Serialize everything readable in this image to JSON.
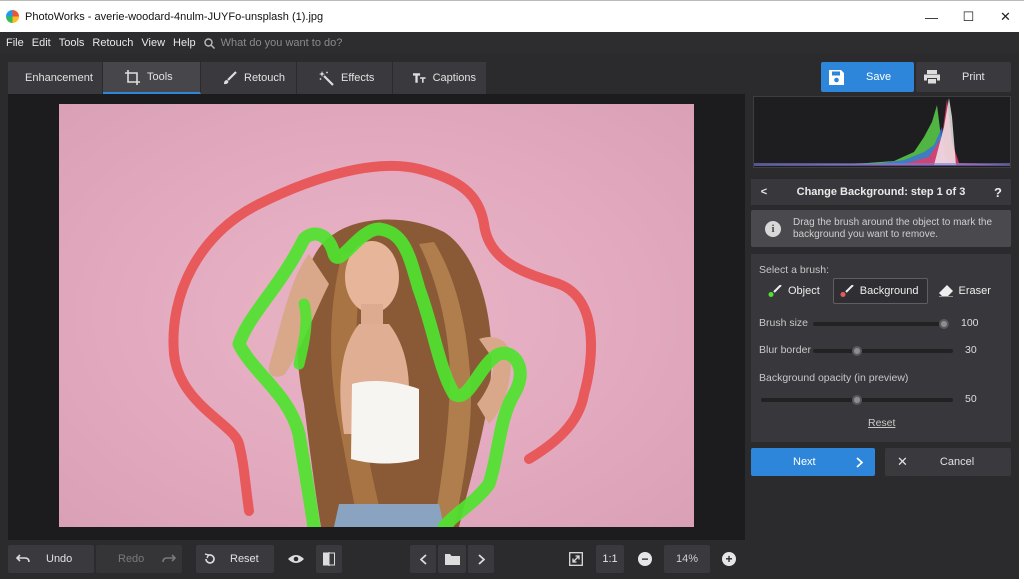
{
  "window": {
    "title": "PhotoWorks - averie-woodard-4nulm-JUYFo-unsplash (1).jpg",
    "minimize": "—",
    "maximize": "☐",
    "close": "✕"
  },
  "menu": {
    "items": [
      "File",
      "Edit",
      "Tools",
      "Retouch",
      "View",
      "Help"
    ],
    "search_placeholder": "What do you want to do?"
  },
  "tabs": [
    {
      "label": "Enhancement",
      "icon": "sliders-icon"
    },
    {
      "label": "Tools",
      "icon": "crop-icon",
      "active": true
    },
    {
      "label": "Retouch",
      "icon": "brush-icon"
    },
    {
      "label": "Effects",
      "icon": "magic-wand-icon"
    },
    {
      "label": "Captions",
      "icon": "text-icon"
    }
  ],
  "toolbar": {
    "save_label": "Save",
    "print_label": "Print"
  },
  "panel": {
    "step_title": "Change Background: step 1 of 3",
    "help": "?",
    "info_text": "Drag the brush around the object to mark the background you want to remove.",
    "select_brush_label": "Select a brush:",
    "brushes": [
      {
        "label": "Object",
        "selected": false
      },
      {
        "label": "Background",
        "selected": true
      },
      {
        "label": "Eraser",
        "selected": false
      }
    ],
    "brush_size_label": "Brush size",
    "brush_size_value": "100",
    "brush_size_level": 1.0,
    "blur_border_label": "Blur border",
    "blur_border_value": "30",
    "blur_border_level": 0.3,
    "bg_opacity_label": "Background opacity (in preview)",
    "bg_opacity_value": "50",
    "bg_opacity_level": 0.5,
    "reset_label": "Reset",
    "next_label": "Next",
    "cancel_label": "Cancel"
  },
  "bottom": {
    "undo_label": "Undo",
    "redo_label": "Redo",
    "reset_label": "Reset",
    "one_to_one": "1:1",
    "zoom": "14%"
  },
  "colors": {
    "accent": "#2d86d9",
    "background_stroke": "#e8595c",
    "object_stroke": "#4fe22f"
  }
}
